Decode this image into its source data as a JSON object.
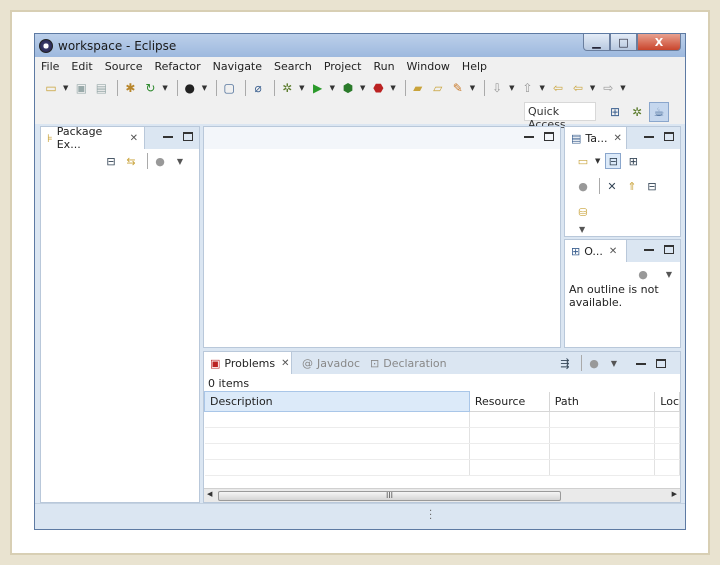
{
  "window": {
    "title": "workspace - Eclipse",
    "controls": {
      "minimize": "▁",
      "maximize": "□",
      "close": "X"
    }
  },
  "menu": [
    "File",
    "Edit",
    "Source",
    "Refactor",
    "Navigate",
    "Search",
    "Project",
    "Run",
    "Window",
    "Help"
  ],
  "quick_access": {
    "label": "Quick Access"
  },
  "package_explorer": {
    "tab": "Package Ex..."
  },
  "task_list": {
    "tab": "Ta..."
  },
  "outline": {
    "tab": "O...",
    "message": "An outline is not available."
  },
  "bottom": {
    "tabs": {
      "problems": "Problems",
      "javadoc": "Javadoc",
      "declaration": "Declaration"
    },
    "item_count": "0 items",
    "columns": {
      "description": "Description",
      "resource": "Resource",
      "path": "Path",
      "location": "Loc"
    },
    "scroll_label": "III"
  },
  "icons": {
    "close": "✕",
    "dropdown": "▼"
  }
}
